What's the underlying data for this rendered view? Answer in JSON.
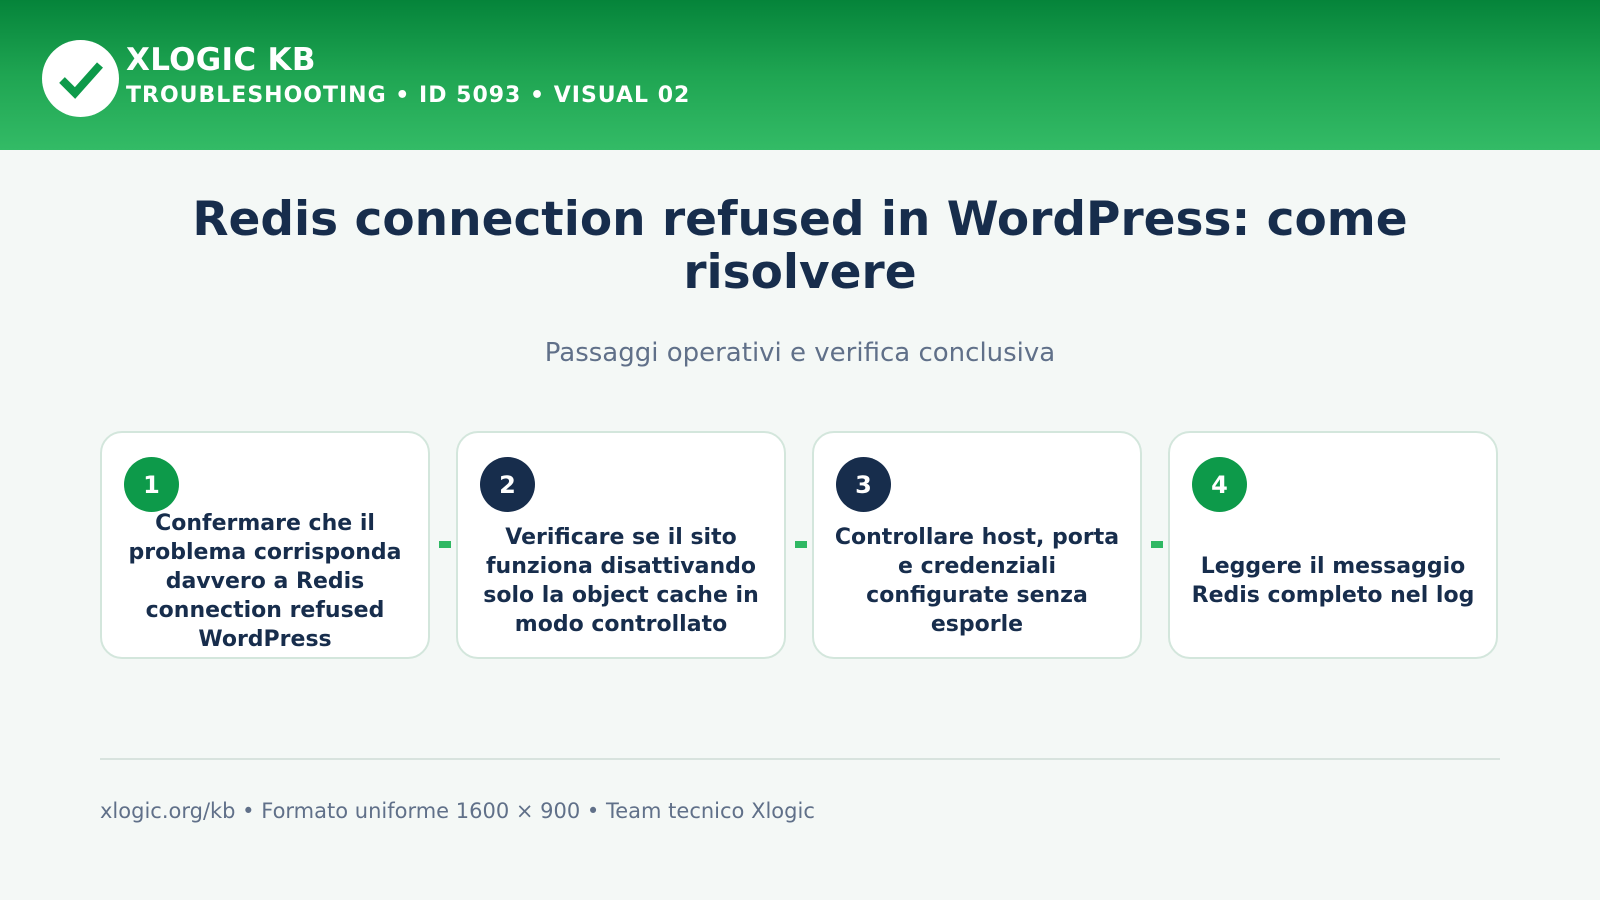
{
  "header": {
    "brand": "XLOGIC KB",
    "crumb": "TROUBLESHOOTING • ID 5093 • VISUAL 02",
    "logo_icon": "check-mark-icon"
  },
  "title": "Redis connection refused in WordPress: come risolvere",
  "subtitle": "Passaggi operativi e verifica conclusiva",
  "steps": [
    {
      "number": "1",
      "text": "Confermare che il problema corrisponda davvero a Redis connection refused WordPress",
      "badge_color": "#0d9a4a"
    },
    {
      "number": "2",
      "text": "Verificare se il sito funziona disattivando solo la object cache in modo controllato",
      "badge_color": "#172d4c"
    },
    {
      "number": "3",
      "text": "Controllare host, porta e credenziali configurate senza esporle",
      "badge_color": "#172d4c"
    },
    {
      "number": "4",
      "text": "Leggere il messaggio Redis completo nel log",
      "badge_color": "#0d9a4a"
    }
  ],
  "footer": "xlogic.org/kb • Formato uniforme 1600 × 900 • Team tecnico Xlogic",
  "colors": {
    "accent_green": "#0d9a4a",
    "header_green": "#1fa552",
    "navy": "#172d4c",
    "muted_text": "#607089",
    "background": "#f4f8f6"
  }
}
